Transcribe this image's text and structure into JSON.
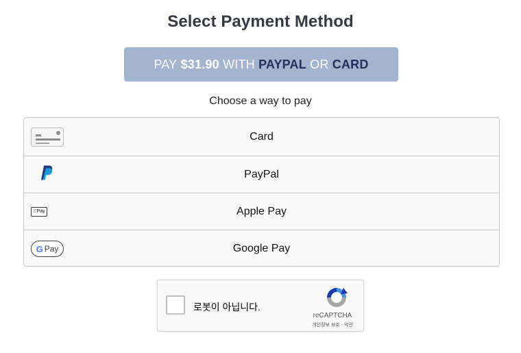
{
  "page": {
    "title": "Select Payment Method",
    "pay_button": {
      "prefix": "PAY",
      "amount": "$31.90",
      "with": "WITH",
      "paypal": "PAYPAL",
      "or": "OR",
      "card": "CARD"
    },
    "choose_label": "Choose a way to pay"
  },
  "methods": [
    {
      "label": "Card",
      "icon": "credit-card-icon"
    },
    {
      "label": "PayPal",
      "icon": "paypal-icon"
    },
    {
      "label": "Apple Pay",
      "icon": "apple-pay-icon",
      "icon_text": "Pay"
    },
    {
      "label": "Google Pay",
      "icon": "google-pay-icon",
      "icon_text_g": "G",
      "icon_text": "Pay"
    }
  ],
  "recaptcha": {
    "label": "로봇이 아닙니다.",
    "brand": "reCAPTCHA",
    "privacy": "개인정보 보호",
    "separator": "-",
    "terms": "약관"
  },
  "colors": {
    "pay_button_bg": "#a3b4ce",
    "pay_button_emphasis": "#23305a",
    "title": "#343a40",
    "border": "#c4c7cc",
    "paypal_dark": "#253b80",
    "paypal_light": "#179bd7",
    "recaptcha_blue": "#1c3aa9",
    "recaptcha_light": "#4a90e2",
    "recaptcha_gray": "#a6a6a6"
  }
}
